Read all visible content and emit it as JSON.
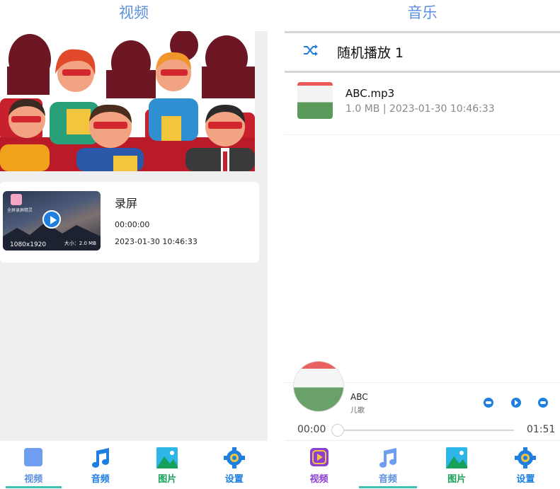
{
  "left": {
    "title": "视频",
    "video": {
      "app_name": "全屏录屏精灵",
      "resolution": "1080x1920",
      "size": "大小：2.0 MB",
      "title": "录屏",
      "duration": "00:00:00",
      "date": "2023-01-30 10:46:33"
    },
    "nav": [
      {
        "label": "视频",
        "icon": "video-icon",
        "color": "#5b8fe0",
        "selected": true
      },
      {
        "label": "音频",
        "icon": "music-icon",
        "color": "#1e7fe0",
        "selected": false
      },
      {
        "label": "图片",
        "icon": "image-icon",
        "color": "#17a05a",
        "selected": false
      },
      {
        "label": "设置",
        "icon": "gear-icon",
        "color": "#1e7fe0",
        "selected": false
      }
    ]
  },
  "right": {
    "title": "音乐",
    "shuffle": {
      "label": "随机播放 1",
      "icon": "shuffle-icon"
    },
    "songs": [
      {
        "name": "ABC.mp3",
        "meta": "1.0 MB  |  2023-01-30 10:46:33"
      }
    ],
    "player": {
      "title": "ABC",
      "artist": "儿歌",
      "current": "00:00",
      "total": "01:51",
      "progress": 0
    },
    "nav": [
      {
        "label": "视频",
        "icon": "video-play-icon",
        "color": "#8a3fd1",
        "selected": false
      },
      {
        "label": "音频",
        "icon": "music-icon",
        "color": "#1e7fe0",
        "selected": true
      },
      {
        "label": "图片",
        "icon": "image-icon",
        "color": "#17a05a",
        "selected": false
      },
      {
        "label": "设置",
        "icon": "gear-icon",
        "color": "#1e7fe0",
        "selected": false
      }
    ]
  }
}
